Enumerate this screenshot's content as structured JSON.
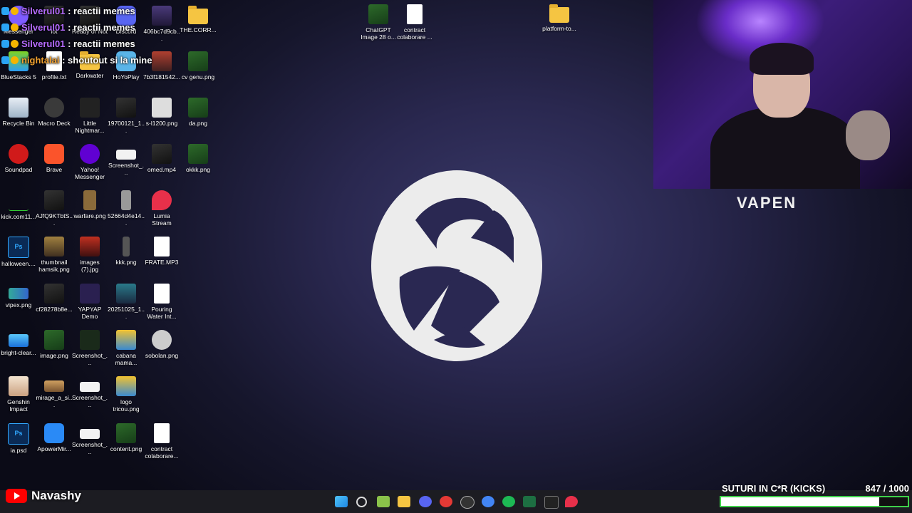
{
  "chat": [
    {
      "user": "Silverul01",
      "text": ": reactii memes",
      "color": "#b66cff"
    },
    {
      "user": "Silverul01",
      "text": ": reactii memes",
      "color": "#b66cff"
    },
    {
      "user": "Silverul01",
      "text": ": reactii memes",
      "color": "#b66cff"
    },
    {
      "user": "nightalai",
      "text": ": shoutout si la mine",
      "color": "#f0a030"
    }
  ],
  "desktop_icons": [
    {
      "label": "Messenger",
      "kind": "app"
    },
    {
      "label": "lot",
      "kind": "img-d"
    },
    {
      "label": "Ready or Not",
      "kind": "img-d"
    },
    {
      "label": "Discord",
      "kind": "app"
    },
    {
      "label": "406bc7d9cb...",
      "kind": "img-d"
    },
    {
      "label": "THE.CORR...",
      "kind": "folder"
    },
    {
      "label": "BlueStacks 5",
      "kind": "app"
    },
    {
      "label": "profile.txt",
      "kind": "doc"
    },
    {
      "label": "Darkwater",
      "kind": "folder"
    },
    {
      "label": "HoYoPlay",
      "kind": "app"
    },
    {
      "label": "7b3f181542...",
      "kind": "img-d"
    },
    {
      "label": "cv genu.png",
      "kind": "img-g"
    },
    {
      "label": "Recycle Bin",
      "kind": "app"
    },
    {
      "label": "Macro Deck",
      "kind": "app"
    },
    {
      "label": "Little Nightmar...",
      "kind": "app"
    },
    {
      "label": "19700121_1...",
      "kind": "img-d"
    },
    {
      "label": "s-l1200.png",
      "kind": "img-d"
    },
    {
      "label": "da.png",
      "kind": "img-g"
    },
    {
      "label": "Soundpad",
      "kind": "app"
    },
    {
      "label": "Brave",
      "kind": "app"
    },
    {
      "label": "Yahoo! Messenger",
      "kind": "app"
    },
    {
      "label": "Screenshot_...",
      "kind": "img-w"
    },
    {
      "label": "omed.mp4",
      "kind": "img-d"
    },
    {
      "label": "okkk.png",
      "kind": "img-g"
    },
    {
      "label": "kick.com11...",
      "kind": "img-d"
    },
    {
      "label": "AJfQ9KTbtS...",
      "kind": "img-d"
    },
    {
      "label": "warfare.png",
      "kind": "img-d"
    },
    {
      "label": "52664d4e14...",
      "kind": "img-d"
    },
    {
      "label": "Lumia Stream",
      "kind": "app"
    },
    {
      "label": "halloween....",
      "kind": "psd"
    },
    {
      "label": "thumbnail hamsik.png",
      "kind": "img-d"
    },
    {
      "label": "images (7).jpg",
      "kind": "img-d"
    },
    {
      "label": "kkk.png",
      "kind": "img-d"
    },
    {
      "label": "FRATE.MP3",
      "kind": "doc"
    },
    {
      "label": "vipex.png",
      "kind": "img-d"
    },
    {
      "label": "cf28278b8e...",
      "kind": "img-d"
    },
    {
      "label": "YAPYAP Demo",
      "kind": "app"
    },
    {
      "label": "20251025_1...",
      "kind": "img-d"
    },
    {
      "label": "Pouring Water Int...",
      "kind": "doc"
    },
    {
      "label": "bright-clear...",
      "kind": "img-d"
    },
    {
      "label": "image.png",
      "kind": "img-g"
    },
    {
      "label": "Screenshot_...",
      "kind": "img-d"
    },
    {
      "label": "cabana mama...",
      "kind": "img-d"
    },
    {
      "label": "sobolan.png",
      "kind": "img-d"
    },
    {
      "label": "Genshin Impact",
      "kind": "app"
    },
    {
      "label": "mirage_a_si...",
      "kind": "img-d"
    },
    {
      "label": "Screenshot_...",
      "kind": "img-w"
    },
    {
      "label": "logo tricou.png",
      "kind": "img-d"
    },
    {
      "label": "ia.psd",
      "kind": "psd"
    },
    {
      "label": "ApowerMir...",
      "kind": "app"
    },
    {
      "label": "Screenshot_...",
      "kind": "img-w"
    },
    {
      "label": "content.png",
      "kind": "img-g"
    },
    {
      "label": "contract colaborare...",
      "kind": "doc"
    },
    {
      "label": "ChatGPT Image 28 o...",
      "kind": "img-g"
    },
    {
      "label": "contract colaborare ...",
      "kind": "doc"
    },
    {
      "label": "platform-to...",
      "kind": "folder"
    }
  ],
  "overlay": {
    "sponsor": "VAPEN",
    "channel": "Navashy",
    "goal_title": "SUTURI IN C*R (KICKS)",
    "goal_count": "847",
    "goal_total": "/ 1000",
    "goal_progress": 0.847
  },
  "taskbar": {
    "icons": [
      "windows-start-icon",
      "search-icon",
      "notepad-icon",
      "file-explorer-icon",
      "discord-icon",
      "youtube-icon",
      "obs-icon",
      "chrome-icon",
      "spotify-icon",
      "excel-icon",
      "epic-games-icon",
      "lumia-icon"
    ]
  },
  "colors": {
    "chat_user": "#b66cff",
    "chat_user2": "#f0a030",
    "goal_border": "#3fd14a"
  }
}
